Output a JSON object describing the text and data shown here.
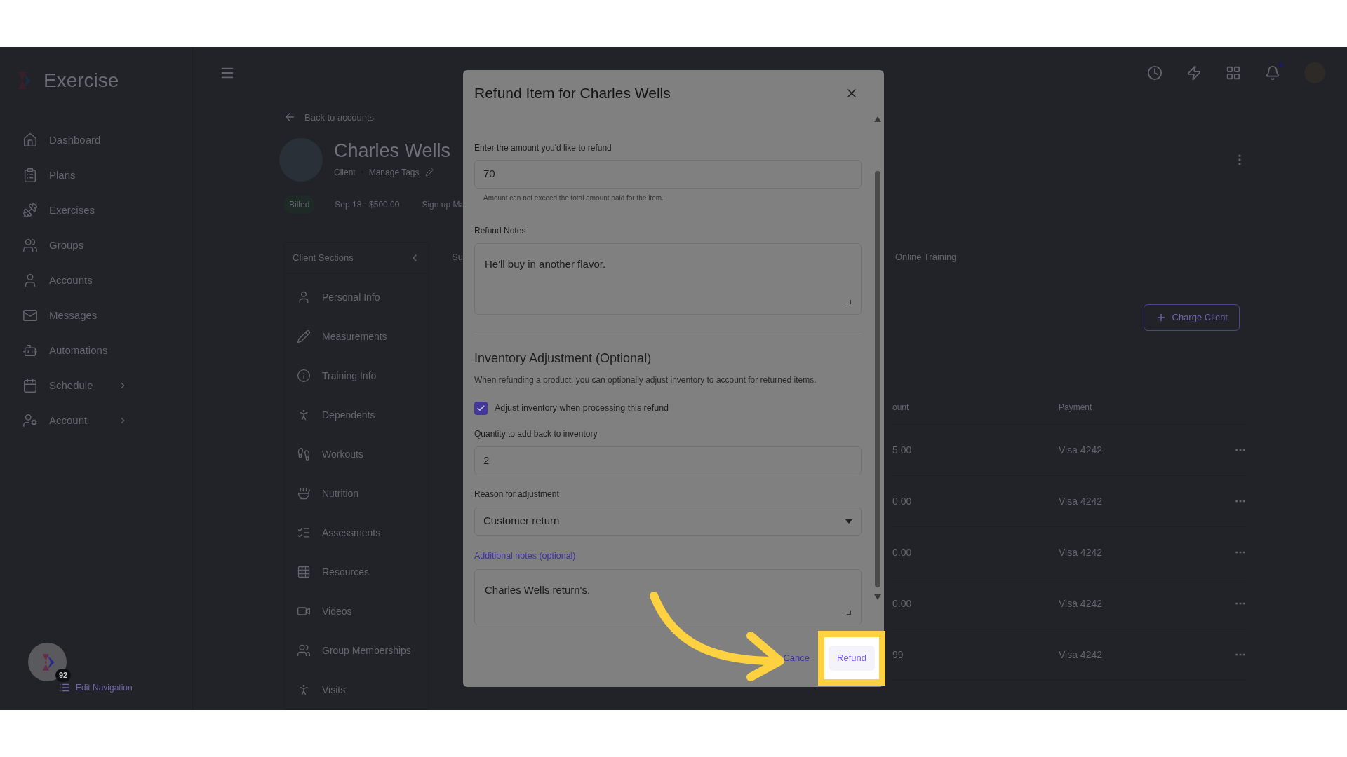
{
  "app": {
    "logo": "Exercise"
  },
  "sidebar": {
    "items": [
      {
        "label": "Dashboard",
        "has_submenu": false
      },
      {
        "label": "Plans",
        "has_submenu": false
      },
      {
        "label": "Exercises",
        "has_submenu": false
      },
      {
        "label": "Groups",
        "has_submenu": false
      },
      {
        "label": "Accounts",
        "has_submenu": false
      },
      {
        "label": "Messages",
        "has_submenu": false
      },
      {
        "label": "Automations",
        "has_submenu": false
      },
      {
        "label": "Schedule",
        "has_submenu": true
      },
      {
        "label": "Account",
        "has_submenu": true
      }
    ],
    "badge": "92",
    "edit_navigation": "Edit Navigation"
  },
  "topbar": {
    "notification_dot": true
  },
  "client": {
    "back": "Back to accounts",
    "name": "Charles Wells",
    "role": "Client",
    "tags_link": "Manage Tags",
    "status": "Billed",
    "billing": "Sep 18 - $500.00",
    "signup": "Sign up Ma"
  },
  "client_sections": {
    "title": "Client Sections",
    "items": [
      "Personal Info",
      "Measurements",
      "Training Info",
      "Dependents",
      "Workouts",
      "Nutrition",
      "Assessments",
      "Resources",
      "Videos",
      "Group Memberships",
      "Visits"
    ]
  },
  "tabs": [
    "Su",
    "Online Training"
  ],
  "charge_button": "Charge Client",
  "table": {
    "columns": [
      "ount",
      "Payment"
    ],
    "rows": [
      {
        "amount": "5.00",
        "payment": "Visa 4242"
      },
      {
        "amount": "0.00",
        "payment": "Visa 4242"
      },
      {
        "amount": "0.00",
        "payment": "Visa 4242"
      },
      {
        "amount": "0.00",
        "payment": "Visa 4242"
      },
      {
        "amount": "99",
        "payment": "Visa 4242"
      }
    ]
  },
  "modal": {
    "title": "Refund Item for Charles Wells",
    "amount_label": "Enter the amount you'd like to refund",
    "amount_value": "70",
    "amount_hint": "Amount can not exceed the total amount paid for the item.",
    "notes_label": "Refund Notes",
    "notes_value": "He'll buy in another flavor.",
    "inventory_title": "Inventory Adjustment (Optional)",
    "inventory_description": "When refunding a product, you can optionally adjust inventory to account for returned items.",
    "adjust": {
      "label": "Adjust inventory when processing this refund",
      "checked": true
    },
    "quantity_label": "Quantity to add back to inventory",
    "quantity_value": "2",
    "reason_label": "Reason for adjustment",
    "reason_value": "Customer return",
    "additional_label": "Additional notes (optional)",
    "additional_value": "Charles Wells return's.",
    "cancel": "Cance",
    "refund": "Refund"
  }
}
